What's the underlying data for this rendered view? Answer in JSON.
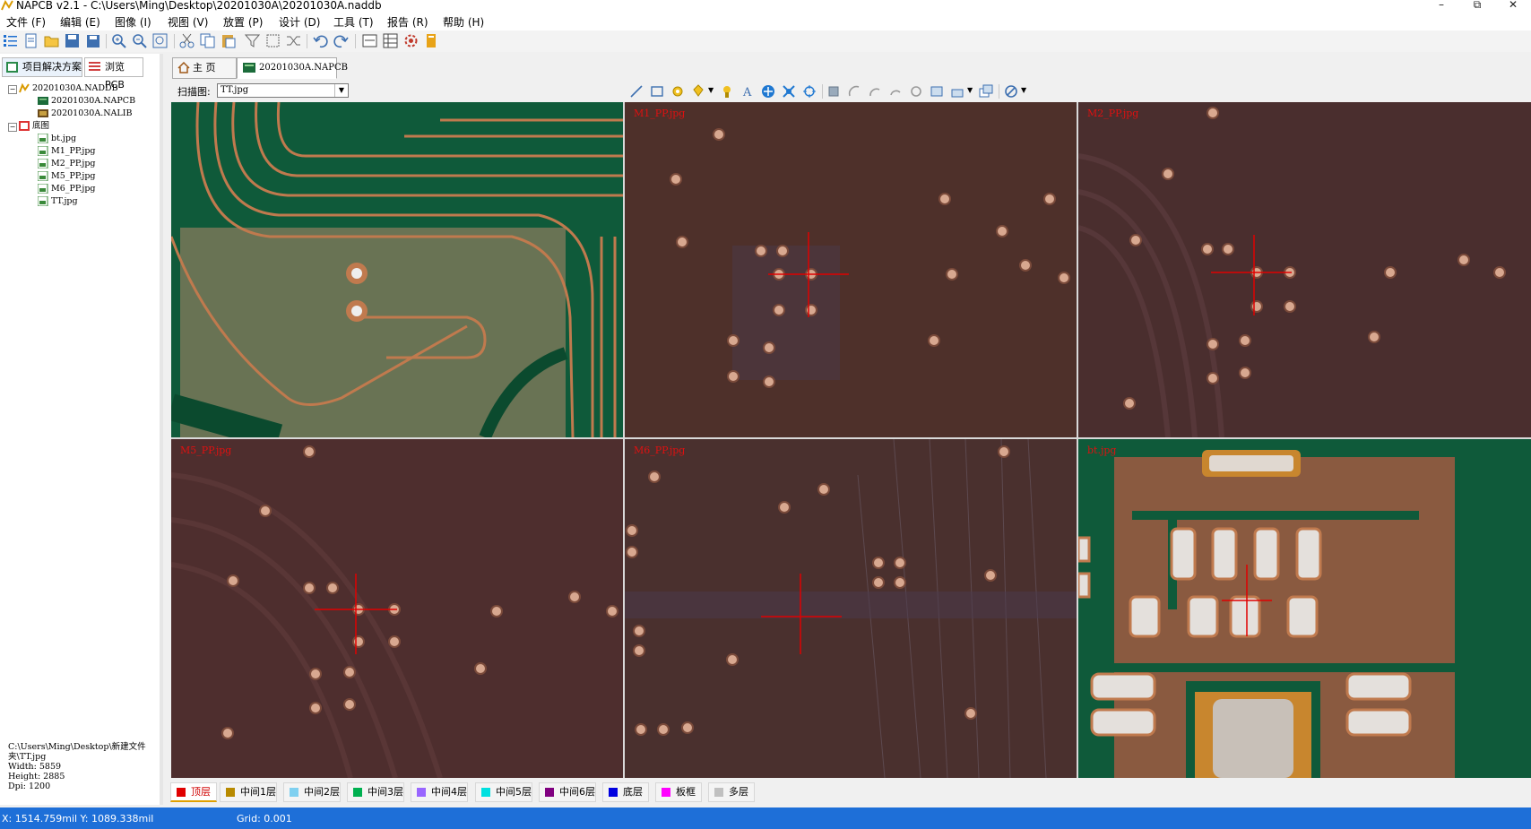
{
  "window": {
    "title": "NAPCB v2.1  -  C:\\Users\\Ming\\Desktop\\20201030A\\20201030A.naddb",
    "min": "–",
    "max": "⧉",
    "close": "✕"
  },
  "menu": [
    "文件 (F)",
    "编辑 (E)",
    "图像 (I)",
    "视图 (V)",
    "放置 (P)",
    "设计 (D)",
    "工具 (T)",
    "报告 (R)",
    "帮助 (H)"
  ],
  "toolbar_icons": [
    "list-icon",
    "new-icon",
    "open-icon",
    "save-icon",
    "save-all-icon",
    "zoom-in-icon",
    "zoom-out-icon",
    "zoom-fit-icon",
    "cut-icon",
    "copy-icon",
    "paste-icon",
    "filter-icon",
    "select-icon",
    "shuffle-icon",
    "undo-icon",
    "redo-icon",
    "layer-icon",
    "table-icon",
    "settings-icon",
    "book-icon"
  ],
  "left_tabs": {
    "project": "项目解决方案",
    "browse": "浏览 PCB"
  },
  "tree": {
    "root": "20201030A.NADDB",
    "napcb": "20201030A.NAPCB",
    "nalib": "20201030A.NALIB",
    "images_folder": "底图",
    "images": [
      "bt.jpg",
      "M1_PP.jpg",
      "M2_PP.jpg",
      "M5_PP.jpg",
      "M6_PP.jpg",
      "TT.jpg"
    ]
  },
  "file_info": {
    "path": "C:\\Users\\Ming\\Desktop\\新建文件夹\\TT.jpg",
    "width": "Width: 5859",
    "height": "Height: 2885",
    "dpi": "Dpi: 1200"
  },
  "doc_tabs": {
    "home": "主  页",
    "napcb": "20201030A.NAPCB"
  },
  "scan": {
    "label": "扫描图:",
    "value": "TT.jpg"
  },
  "panes": [
    "",
    "M1_PP.jpg",
    "M2_PP.jpg",
    "M5_PP.jpg",
    "M6_PP.jpg",
    "bt.jpg"
  ],
  "layers": [
    {
      "label": "顶层",
      "color": "#e00000"
    },
    {
      "label": "中间1层",
      "color": "#b88a00"
    },
    {
      "label": "中间2层",
      "color": "#7fd0f0"
    },
    {
      "label": "中间3层",
      "color": "#00b050"
    },
    {
      "label": "中间4层",
      "color": "#9966ff"
    },
    {
      "label": "中间5层",
      "color": "#00e0e0"
    },
    {
      "label": "中间6层",
      "color": "#800080"
    },
    {
      "label": "底层",
      "color": "#0000e0"
    },
    {
      "label": "板框",
      "color": "#ff00ff"
    },
    {
      "label": "多层",
      "color": "#c0c0c0"
    }
  ],
  "status": {
    "coords": "X: 1514.759mil  Y: 1089.338mil",
    "grid": "Grid: 0.001"
  },
  "colors": {
    "pcb_green": "#0f5a3a",
    "copper": "#c07a4e",
    "board_brown": "#4a2a24",
    "crosshair": "#e00000",
    "status_blue": "#1e6fd8"
  }
}
